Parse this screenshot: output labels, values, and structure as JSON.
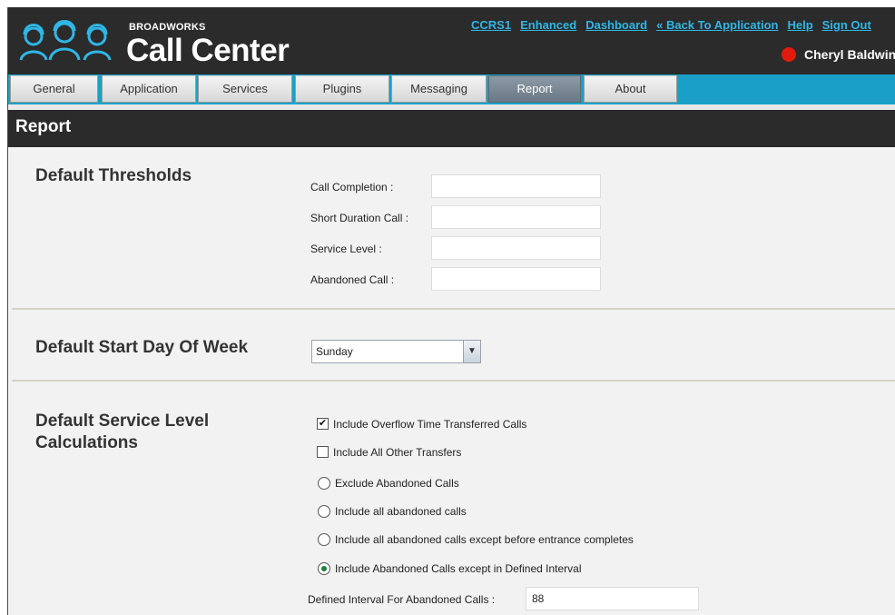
{
  "header": {
    "brand_small": "BROADWORKS",
    "brand_big": "Call Center",
    "links": [
      "CCRS1",
      "Enhanced",
      "Dashboard",
      "« Back To Application",
      "Help",
      "Sign Out"
    ],
    "user_name": "Cheryl Baldwin",
    "status_color": "#e21a0e"
  },
  "tabs": [
    "General",
    "Application",
    "Services",
    "Plugins",
    "Messaging",
    "Report",
    "About"
  ],
  "active_tab": "Report",
  "page_title": "Report",
  "thresholds": {
    "title": "Default Thresholds",
    "fields": [
      {
        "label": "Call Completion :",
        "value": ""
      },
      {
        "label": "Short Duration Call :",
        "value": ""
      },
      {
        "label": "Service Level :",
        "value": ""
      },
      {
        "label": "Abandoned Call :",
        "value": ""
      }
    ]
  },
  "start_day": {
    "title": "Default Start Day Of Week",
    "selected": "Sunday"
  },
  "service_level": {
    "title_line1": "Default Service Level",
    "title_line2": "Calculations",
    "checkboxes": [
      {
        "label": "Include Overflow Time Transferred Calls",
        "checked": true
      },
      {
        "label": "Include All Other Transfers",
        "checked": false
      }
    ],
    "radios": [
      {
        "label": "Exclude Abandoned Calls",
        "selected": false
      },
      {
        "label": "Include all abandoned calls",
        "selected": false
      },
      {
        "label": "Include all abandoned calls except before entrance completes",
        "selected": false
      },
      {
        "label": "Include Abandoned Calls except in Defined Interval",
        "selected": true
      }
    ],
    "interval_label": "Defined Interval For Abandoned Calls :",
    "interval_value": "88"
  }
}
